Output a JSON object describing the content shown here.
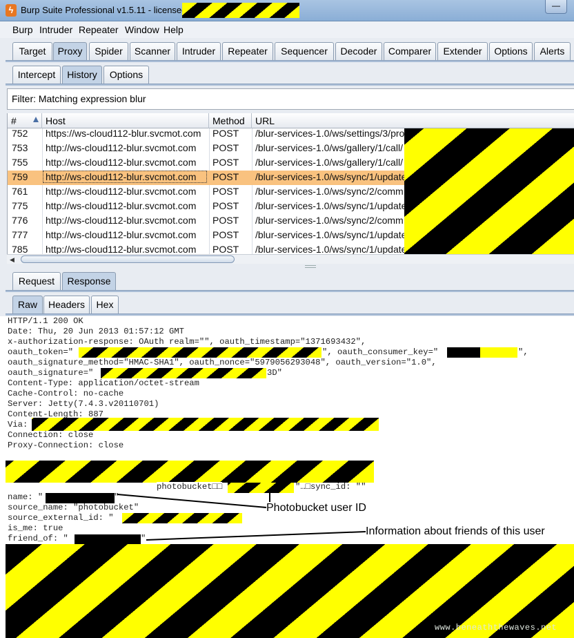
{
  "window": {
    "title": "Burp Suite Professional v1.5.11 - licensed to",
    "minimize_glyph": "—",
    "icon_glyph": "ϟ"
  },
  "menu": [
    "Burp",
    "Intruder",
    "Repeater",
    "Window",
    "Help"
  ],
  "main_tabs": [
    "Target",
    "Proxy",
    "Spider",
    "Scanner",
    "Intruder",
    "Repeater",
    "Sequencer",
    "Decoder",
    "Comparer",
    "Extender",
    "Options",
    "Alerts"
  ],
  "proxy_tabs": [
    "Intercept",
    "History",
    "Options"
  ],
  "filter": {
    "text": "Filter: Matching expression blur"
  },
  "history_table": {
    "columns": [
      "#",
      "Host",
      "Method",
      "URL"
    ],
    "rows": [
      {
        "num": "752",
        "host": "https://ws-cloud112-blur.svcmot.com",
        "method": "POST",
        "url": "/blur-services-1.0/ws/settings/3/pro"
      },
      {
        "num": "753",
        "host": "http://ws-cloud112-blur.svcmot.com",
        "method": "POST",
        "url": "/blur-services-1.0/ws/gallery/1/call/"
      },
      {
        "num": "755",
        "host": "http://ws-cloud112-blur.svcmot.com",
        "method": "POST",
        "url": "/blur-services-1.0/ws/gallery/1/call/"
      },
      {
        "num": "759",
        "host": "http://ws-cloud112-blur.svcmot.com",
        "method": "POST",
        "url": "/blur-services-1.0/ws/sync/1/update"
      },
      {
        "num": "761",
        "host": "http://ws-cloud112-blur.svcmot.com",
        "method": "POST",
        "url": "/blur-services-1.0/ws/sync/2/comm"
      },
      {
        "num": "775",
        "host": "http://ws-cloud112-blur.svcmot.com",
        "method": "POST",
        "url": "/blur-services-1.0/ws/sync/1/update"
      },
      {
        "num": "776",
        "host": "http://ws-cloud112-blur.svcmot.com",
        "method": "POST",
        "url": "/blur-services-1.0/ws/sync/2/comm"
      },
      {
        "num": "777",
        "host": "http://ws-cloud112-blur.svcmot.com",
        "method": "POST",
        "url": "/blur-services-1.0/ws/sync/1/update"
      },
      {
        "num": "785",
        "host": "http://ws-cloud112-blur.svcmot.com",
        "method": "POST",
        "url": "/blur-services-1.0/ws/sync/1/update"
      }
    ],
    "selected_num": "759"
  },
  "message_tabs": [
    "Request",
    "Response"
  ],
  "view_tabs": [
    "Raw",
    "Headers",
    "Hex"
  ],
  "response": {
    "status_line": "HTTP/1.1 200 OK",
    "date": "Date: Thu, 20 Jun 2013 01:57:12 GMT",
    "auth_response": "x-authorization-response: OAuth realm=\"\", oauth_timestamp=\"1371693432\",",
    "oauth_token_prefix": "oauth_token=\"",
    "oauth_token_suffix": "\", oauth_consumer_key=\"",
    "oauth_consumer_key_end": "\",",
    "oauth_sig_method": "oauth_signature_method=\"HMAC-SHA1\", oauth_nonce=\"5979056293048\", oauth_version=\"1.0\",",
    "oauth_signature_prefix": "oauth_signature=\"",
    "oauth_signature_suffix": "3D\"",
    "content_type": "Content-Type: application/octet-stream",
    "cache_control": "Cache-Control: no-cache",
    "server": "Server: Jetty(7.4.3.v20110701)",
    "content_length": "Content-Length: 887",
    "via": "Via:",
    "connection": "Connection: close",
    "proxy_connection": "Proxy-Connection: close",
    "body_photobucket": "photobucket□□",
    "body_sync_id": "\"…□sync_id: \"\"",
    "name_line": "name: \"",
    "name_close": "\"",
    "source_name": "source_name: \"photobucket\"",
    "source_external_id": "source_external_id: \"",
    "is_me": "is_me: true",
    "friend_of": "friend_of: \"",
    "friend_close": "\""
  },
  "annotations": {
    "user_id": "Photobucket user ID",
    "friends": "Information about friends of this user"
  },
  "watermark": "www.beneaththewaves.net"
}
